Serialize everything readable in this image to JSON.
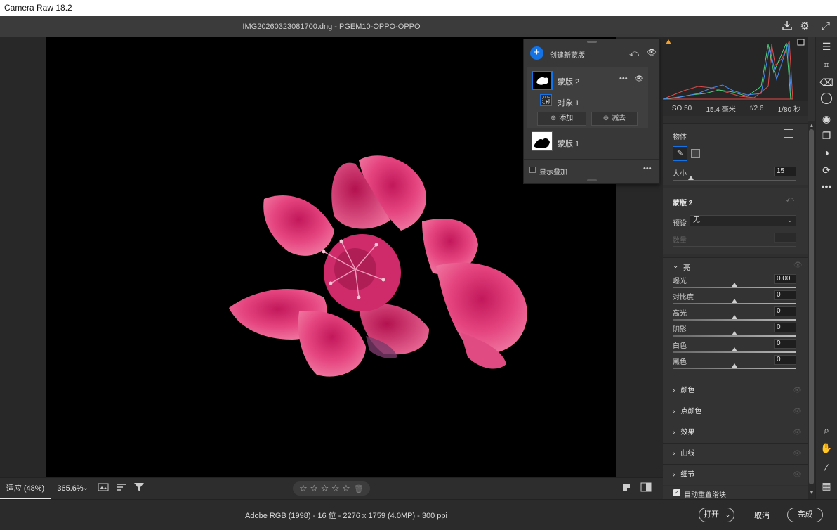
{
  "window": {
    "title": "Camera Raw 18.2"
  },
  "header": {
    "filename": "IMG20260323081700.dng - PGEM10-OPPO-OPPO"
  },
  "view": {
    "zoom_fit": "适应 (48%)",
    "zoom_pct": "365.6%"
  },
  "rating": {
    "stars": "☆ ☆ ☆ ☆ ☆"
  },
  "footer": {
    "fileinfo": "Adobe RGB (1998) - 16 位 - 2276 x 1759 (4.0MP) - 300 ppi",
    "open": "打开",
    "cancel": "取消",
    "done": "完成"
  },
  "exif": {
    "iso": "ISO 50",
    "focal": "15.4 毫米",
    "aperture": "f/2.6",
    "shutter": "1/80 秒"
  },
  "object_section": {
    "title": "物体",
    "size_label": "大小",
    "size_value": "15",
    "size_level": 0.15
  },
  "mask2_section": {
    "title": "蒙版 2",
    "preset_label": "预设",
    "preset_value": "无",
    "amount_label": "数量"
  },
  "light": {
    "title": "亮",
    "rows": [
      {
        "label": "曝光",
        "value": "0.00"
      },
      {
        "label": "对比度",
        "value": "0"
      },
      {
        "label": "高光",
        "value": "0"
      },
      {
        "label": "阴影",
        "value": "0"
      },
      {
        "label": "白色",
        "value": "0"
      },
      {
        "label": "黑色",
        "value": "0"
      }
    ]
  },
  "collapsed": [
    "颜色",
    "点颜色",
    "效果",
    "曲线",
    "细节"
  ],
  "auto_reset": {
    "label": "自动重置滑块",
    "checked": true
  },
  "masks_panel": {
    "create": "创建新蒙版",
    "mask2": "蒙版 2",
    "object1": "对象 1",
    "add": "添加",
    "subtract": "减去",
    "mask1": "蒙版 1",
    "show_overlay": "显示叠加"
  },
  "colors": {
    "accent": "#1473e6",
    "panel": "#333333",
    "background": "#323232"
  }
}
